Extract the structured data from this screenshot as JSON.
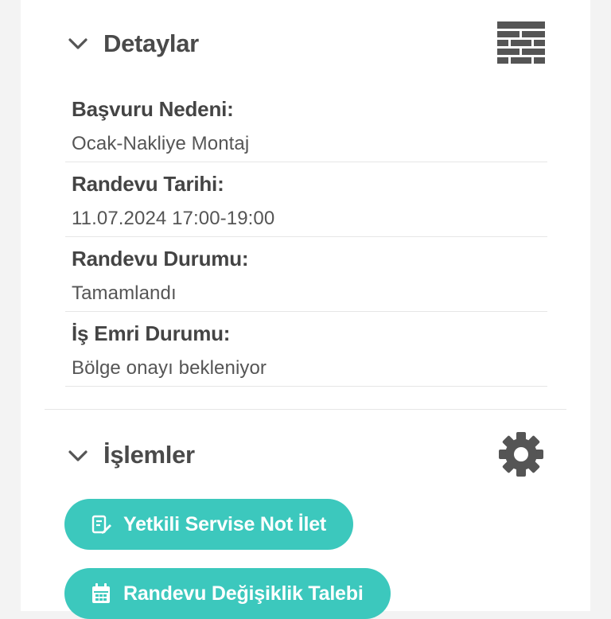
{
  "details": {
    "title": "Detaylar",
    "fields": [
      {
        "label": "Başvuru Nedeni:",
        "value": "Ocak-Nakliye Montaj"
      },
      {
        "label": "Randevu Tarihi:",
        "value": "11.07.2024 17:00-19:00"
      },
      {
        "label": "Randevu Durumu:",
        "value": "Tamamlandı"
      },
      {
        "label": "İş Emri Durumu:",
        "value": "Bölge onayı bekleniyor"
      }
    ],
    "icon": "table-icon"
  },
  "actions": {
    "title": "İşlemler",
    "icon": "gear-icon",
    "buttons": [
      {
        "label": "Yetkili Servise Not İlet",
        "icon": "note-edit-icon"
      },
      {
        "label": "Randevu Değişiklik Talebi",
        "icon": "calendar-icon"
      }
    ]
  },
  "colors": {
    "accent": "#3cc8bd",
    "text_dark": "#444444",
    "icon_gray": "#555555"
  }
}
